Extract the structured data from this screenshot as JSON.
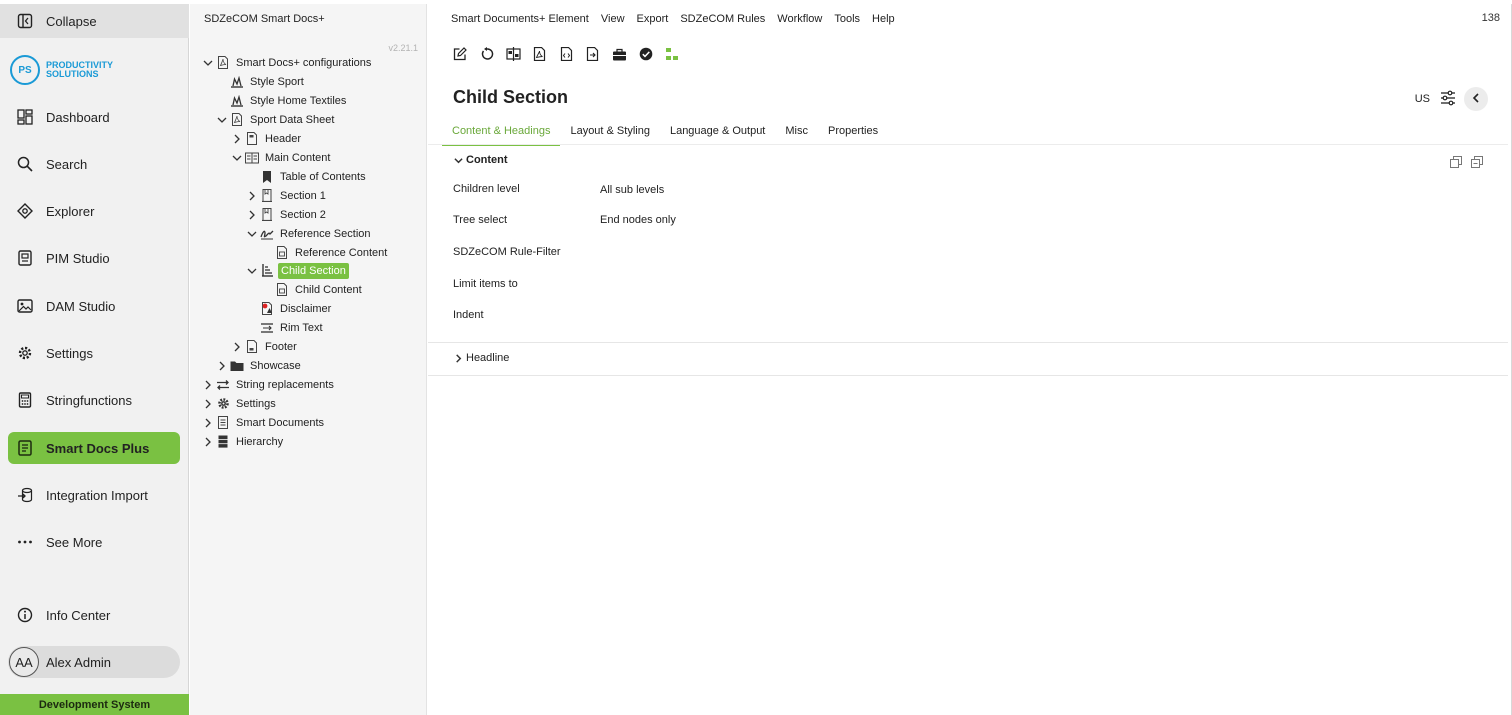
{
  "nav": {
    "collapse": "Collapse",
    "logo_line1": "PRODUCTIVITY",
    "logo_line2": "SOLUTIONS",
    "logo_mark": "PS",
    "items": [
      {
        "label": "Dashboard",
        "icon": "dashboard-icon"
      },
      {
        "label": "Search",
        "icon": "search-icon"
      },
      {
        "label": "Explorer",
        "icon": "explorer-icon"
      },
      {
        "label": "PIM Studio",
        "icon": "pim-icon"
      },
      {
        "label": "DAM Studio",
        "icon": "image-icon"
      },
      {
        "label": "Settings",
        "icon": "gear-icon"
      },
      {
        "label": "Stringfunctions",
        "icon": "calculator-icon"
      },
      {
        "label": "Smart Docs Plus",
        "icon": "document-icon"
      },
      {
        "label": "Integration Import",
        "icon": "import-icon"
      },
      {
        "label": "See More",
        "icon": "more-icon"
      }
    ],
    "info_center": "Info Center",
    "user_initials": "AA",
    "user_name": "Alex Admin",
    "environment": "Development System"
  },
  "tree": {
    "title": "SDZeCOM Smart Docs+",
    "version": "v2.21.1",
    "nodes": [
      {
        "label": "Smart Docs+ configurations",
        "expanded": true
      },
      {
        "label": "Style Sport"
      },
      {
        "label": "Style Home Textiles"
      },
      {
        "label": "Sport Data Sheet",
        "expanded": true
      },
      {
        "label": "Header",
        "expanded": false
      },
      {
        "label": "Main Content",
        "expanded": true
      },
      {
        "label": "Table of Contents"
      },
      {
        "label": "Section 1",
        "expanded": false
      },
      {
        "label": "Section 2",
        "expanded": false
      },
      {
        "label": "Reference Section",
        "expanded": true
      },
      {
        "label": "Reference Content"
      },
      {
        "label": "Child Section",
        "expanded": true,
        "selected": true
      },
      {
        "label": "Child Content"
      },
      {
        "label": "Disclaimer"
      },
      {
        "label": "Rim Text"
      },
      {
        "label": "Footer",
        "expanded": false
      },
      {
        "label": "Showcase",
        "expanded": false
      },
      {
        "label": "String replacements",
        "expanded": false
      },
      {
        "label": "Settings",
        "expanded": false
      },
      {
        "label": "Smart Documents",
        "expanded": false
      },
      {
        "label": "Hierarchy",
        "expanded": false
      }
    ]
  },
  "menu": [
    "Smart Documents+ Element",
    "View",
    "Export",
    "SDZeCOM Rules",
    "Workflow",
    "Tools",
    "Help"
  ],
  "counter": "138",
  "toolbar": [
    "edit-icon",
    "reload-icon",
    "compare-icon",
    "pdf-icon",
    "code-icon",
    "export-file-icon",
    "briefcase-icon",
    "check-circle-icon",
    "hierarchy-icon"
  ],
  "title": "Child Section",
  "locale": "US",
  "tabs": [
    "Content & Headings",
    "Layout & Styling",
    "Language & Output",
    "Misc",
    "Properties"
  ],
  "content": {
    "section_title": "Content",
    "fields": [
      {
        "label": "Children level",
        "value": "All sub levels"
      },
      {
        "label": "Tree select",
        "value": "End nodes only"
      },
      {
        "label": "SDZeCOM Rule-Filter",
        "value": ""
      },
      {
        "label": "Limit items to",
        "value": ""
      },
      {
        "label": "Indent",
        "value": ""
      }
    ]
  },
  "headline_section": "Headline",
  "colors": {
    "accent": "#7ac142",
    "brand": "#1a9ad6"
  }
}
